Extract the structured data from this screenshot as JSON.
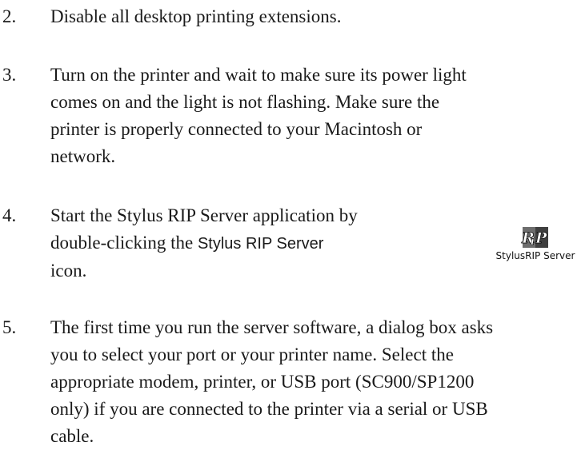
{
  "steps": [
    {
      "number": "2.",
      "lines": [
        "Disable all desktop printing extensions."
      ]
    },
    {
      "number": "3.",
      "lines": [
        "Turn on the printer and wait to make sure its power light",
        "comes on and the light is not flashing. Make sure the",
        "printer is properly connected to your Macintosh or",
        "network."
      ]
    },
    {
      "number": "4.",
      "line1": "Start the Stylus RIP Server application by",
      "line2_before": "double-clicking the ",
      "line2_ui": "Stylus RIP Server",
      "line3": "icon."
    },
    {
      "number": "5.",
      "lines": [
        "The first time you run the server software, a dialog box asks",
        "you to select your port or your printer name. Select the",
        "appropriate modem, printer, or USB port (SC900/SP1200",
        "only) if you are connected to the printer via a serial or USB",
        "cable."
      ]
    }
  ],
  "icon": {
    "name": "stylus-rip-server-icon",
    "label": "StylusRIP Server"
  }
}
